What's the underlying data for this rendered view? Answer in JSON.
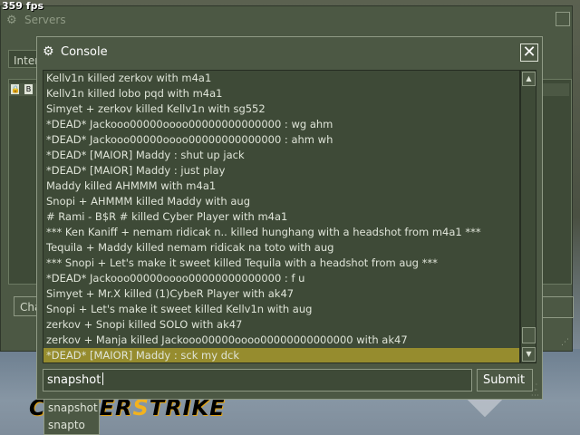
{
  "hud": {
    "fps": "359 fps"
  },
  "game": {
    "logo_left": "C",
    "logo_mid": "UNTER",
    "logo_hl": "S",
    "logo_right": "TRIKE"
  },
  "servers": {
    "title": "Servers",
    "tab_label": "Inter",
    "col1_icon": "lock-icon",
    "col2_icon": "bot-icon",
    "button_label": "Cha"
  },
  "console": {
    "title": "Console",
    "icon": "steam-icon",
    "close_glyph": "✕",
    "log": [
      "Kellv1n killed zerkov with m4a1",
      "Kellv1n killed lobo pqd with m4a1",
      "Simyet + zerkov killed Kellv1n with sg552",
      "*DEAD* Jackooo00000oooo00000000000000 : wg ahm",
      "*DEAD* Jackooo00000oooo00000000000000 : ahm wh",
      "*DEAD* [MAIOR] Maddy : shut up jack",
      "*DEAD* [MAIOR] Maddy : just play",
      "Maddy killed AHMMM with m4a1",
      "Snopi + AHMMM killed Maddy with aug",
      "#  Rami - B$R  #  killed Cyber Player with m4a1",
      "*** Ken Kaniff + nemam ridicak n.. killed hunghang with a headshot from m4a1 ***",
      "Tequila + Maddy killed nemam ridicak na toto with aug",
      "*** Snopi + Let's make it sweet killed Tequila with a headshot from aug ***",
      "*DEAD* Jackooo00000oooo00000000000000 : f u",
      "Simyet + Mr.X killed (1)CybeR Player with ak47",
      "Snopi + Let's make it sweet killed Kellv1n with aug",
      "zerkov + Snopi killed SOLO with ak47",
      "zerkov + Manja killed Jackooo00000oooo00000000000000 with ak47",
      "*DEAD* [MAIOR] Maddy : sck my dck"
    ],
    "highlighted_index": 18,
    "input_value": "snapshot",
    "submit_label": "Submit",
    "scroll_up": "▲",
    "scroll_down": "▼"
  },
  "autocomplete": {
    "items": [
      "snapshot",
      "snapto"
    ]
  }
}
